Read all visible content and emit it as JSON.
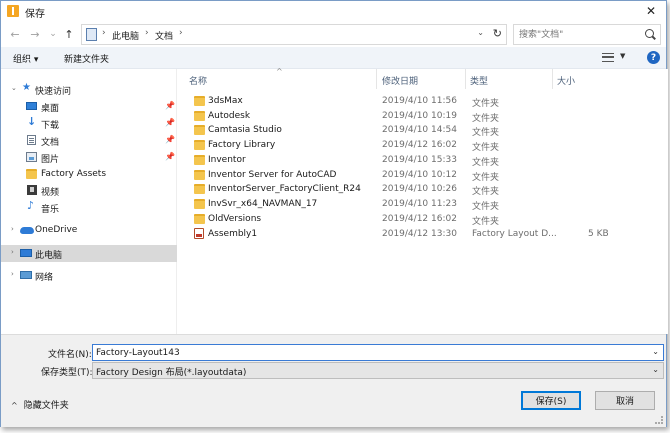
{
  "window": {
    "title": "保存",
    "close_glyph": "✕"
  },
  "address_bar": {
    "back_glyph": "←",
    "forward_glyph": "→",
    "recent_glyph": "⌄",
    "up_glyph": "↑",
    "crumbs": [
      "此电脑",
      "文档"
    ],
    "separator": "›",
    "dropdown_glyph": "⌄",
    "refresh_glyph": "↻"
  },
  "search": {
    "placeholder": "搜索\"文档\""
  },
  "toolbar": {
    "organize_label": "组织 ▾",
    "new_folder_label": "新建文件夹",
    "view_drop_glyph": "▼",
    "help_label": "?"
  },
  "nav": {
    "expand_glyph": "›",
    "expanded_glyph": "⌄",
    "pin_glyph": "📌",
    "quick_access": {
      "label": "快速访问",
      "icon": "star-icon",
      "glyph": "★"
    },
    "items": [
      {
        "label": "桌面",
        "icon": "desktop-icon",
        "pinned": true
      },
      {
        "label": "下载",
        "icon": "download-icon",
        "pinned": true,
        "glyph": "↓"
      },
      {
        "label": "文档",
        "icon": "documents-icon",
        "pinned": true
      },
      {
        "label": "图片",
        "icon": "pictures-icon",
        "pinned": true
      },
      {
        "label": "Factory Assets",
        "icon": "folder-icon",
        "pinned": false
      },
      {
        "label": "视频",
        "icon": "video-icon",
        "pinned": false
      },
      {
        "label": "音乐",
        "icon": "music-icon",
        "pinned": false,
        "glyph": "♪"
      }
    ],
    "onedrive": {
      "label": "OneDrive",
      "icon": "onedrive-icon"
    },
    "this_pc": {
      "label": "此电脑",
      "icon": "pc-icon",
      "selected": true
    },
    "network": {
      "label": "网络",
      "icon": "network-icon"
    }
  },
  "files": {
    "sort_glyph": "^",
    "columns": {
      "name": "名称",
      "date": "修改日期",
      "type": "类型",
      "size": "大小"
    },
    "rows": [
      {
        "name": "3dsMax",
        "date": "2019/4/10 11:56",
        "type": "文件夹",
        "size": "",
        "kind": "folder"
      },
      {
        "name": "Autodesk",
        "date": "2019/4/10 10:19",
        "type": "文件夹",
        "size": "",
        "kind": "folder"
      },
      {
        "name": "Camtasia Studio",
        "date": "2019/4/10 14:54",
        "type": "文件夹",
        "size": "",
        "kind": "folder"
      },
      {
        "name": "Factory Library",
        "date": "2019/4/12 16:02",
        "type": "文件夹",
        "size": "",
        "kind": "folder"
      },
      {
        "name": "Inventor",
        "date": "2019/4/10 15:33",
        "type": "文件夹",
        "size": "",
        "kind": "folder"
      },
      {
        "name": "Inventor Server for AutoCAD",
        "date": "2019/4/10 10:12",
        "type": "文件夹",
        "size": "",
        "kind": "folder"
      },
      {
        "name": "InventorServer_FactoryClient_R24",
        "date": "2019/4/10 10:26",
        "type": "文件夹",
        "size": "",
        "kind": "folder"
      },
      {
        "name": "InvSvr_x64_NAVMAN_17",
        "date": "2019/4/10 11:23",
        "type": "文件夹",
        "size": "",
        "kind": "folder"
      },
      {
        "name": "OldVersions",
        "date": "2019/4/12 16:02",
        "type": "文件夹",
        "size": "",
        "kind": "folder"
      },
      {
        "name": "Assembly1",
        "date": "2019/4/12 13:30",
        "type": "Factory Layout D...",
        "size": "5 KB",
        "kind": "file"
      }
    ]
  },
  "form": {
    "filename_label": "文件名(N):",
    "filename_value": "Factory-Layout143",
    "filename_drop_glyph": "⌄",
    "filetype_label": "保存类型(T):",
    "filetype_value": "Factory Design 布局(*.layoutdata)",
    "filetype_drop_glyph": "⌄",
    "hide_folders_glyph": "^",
    "hide_folders_label": "隐藏文件夹",
    "save_label": "保存(S)",
    "cancel_label": "取消"
  }
}
